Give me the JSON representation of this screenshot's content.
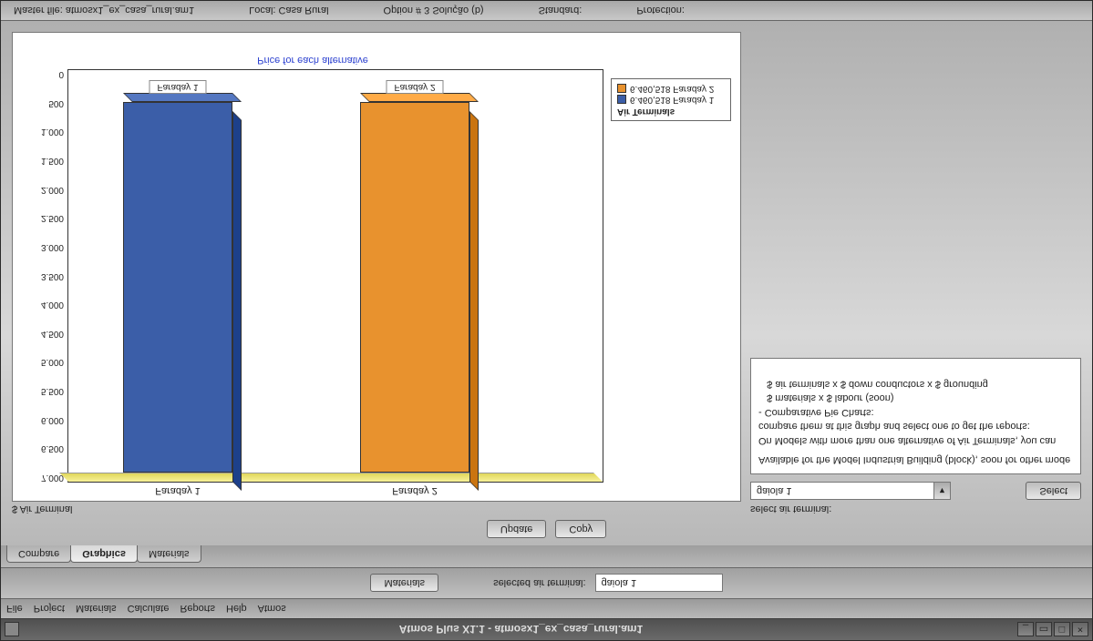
{
  "window": {
    "title": "Atmos Plus X1.1 - atmosx1_ex_casa_rural.am1"
  },
  "menubar": [
    "File",
    "Project",
    "Materials",
    "Calculate",
    "Reports",
    "Help",
    "Atmos"
  ],
  "toolbar": {
    "materials_btn": "Materials",
    "selected_label": "selected air terminal:",
    "selected_value": "gaiola 1"
  },
  "tabs": {
    "compare": "Compare",
    "graphics": "Graphics",
    "materials": "Materials"
  },
  "actions": {
    "update": "Update",
    "copy": "Copy",
    "select": "Select"
  },
  "left": {
    "title": "$ Air Terminal"
  },
  "right": {
    "label": "select air terminal:",
    "dropdown": "gaiola 1",
    "info_l1": "Available for the Model Industrial Building (block), soon for other mode",
    "info_l2": "On Models with more than one alternative of Air Terminals, you can",
    "info_l3": "compare them at this graph and select one to get the reports:",
    "info_l4": "- Comparative Pie Charts:",
    "info_l5": "   $ materials x $ labour (soon)",
    "info_l6": "   $ air terminals x $ down conductors x $ grounding"
  },
  "chart_data": {
    "type": "bar",
    "title": "Price for each alternative",
    "ylabel": "",
    "ylim": [
      0,
      7000
    ],
    "yticks": [
      "0",
      "500",
      "1.000",
      "1.500",
      "2.000",
      "2.500",
      "3.000",
      "3.500",
      "4.000",
      "4.500",
      "5.000",
      "5.500",
      "6.000",
      "6.500",
      "7.000"
    ],
    "categories": [
      "Faraday 1",
      "Faraday 2"
    ],
    "values": [
      6460.518,
      6460.518
    ],
    "colors": [
      "#3b5ea8",
      "#e8922e"
    ],
    "legend_title": "Air Terminals",
    "legend": [
      {
        "label": "Faraday 1",
        "value": "6.460,518",
        "color": "#3b5ea8"
      },
      {
        "label": "Faraday 2",
        "value": "6.460,518",
        "color": "#e8922e"
      }
    ]
  },
  "status": {
    "master": "Master file: atmosx1_ex_casa_rural.am1",
    "local": "Local: Casa Rural",
    "option": "Option # 3 Solução (b)",
    "standard": "Standard:",
    "protection": "Protection:"
  }
}
